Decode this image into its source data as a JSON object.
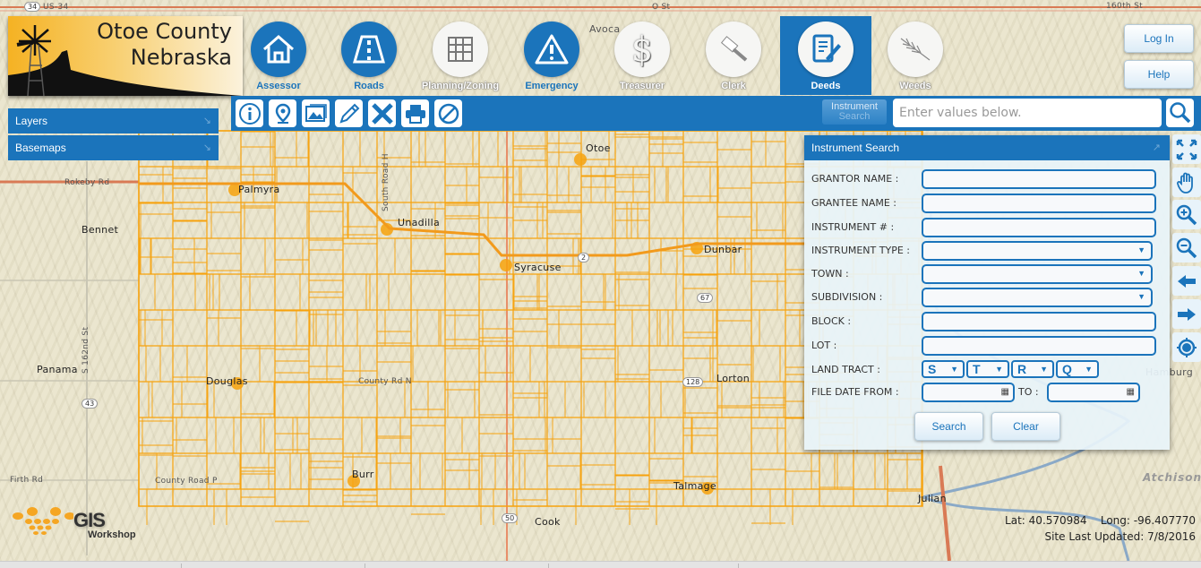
{
  "header": {
    "title_line1": "Otoe County",
    "title_line2": "Nebraska",
    "departments": [
      {
        "label": "Assessor",
        "icon": "house-icon",
        "style": "blue"
      },
      {
        "label": "Roads",
        "icon": "road-icon",
        "style": "blue"
      },
      {
        "label": "Planning/Zoning",
        "icon": "parcel-grid-icon",
        "style": "white"
      },
      {
        "label": "Emergency",
        "icon": "warning-icon",
        "style": "blue"
      },
      {
        "label": "Treasurer",
        "icon": "dollar-icon",
        "style": "white"
      },
      {
        "label": "Clerk",
        "icon": "gavel-icon",
        "style": "white"
      },
      {
        "label": "Deeds",
        "icon": "document-pen-icon",
        "style": "active"
      },
      {
        "label": "Weeds",
        "icon": "wheat-icon",
        "style": "white"
      }
    ],
    "login_label": "Log In",
    "help_label": "Help",
    "active_department": "Deeds"
  },
  "toolbar": {
    "tools": [
      {
        "name": "identify",
        "icon": "info-icon"
      },
      {
        "name": "locate",
        "icon": "map-pin-icon"
      },
      {
        "name": "imagery",
        "icon": "image-icon"
      },
      {
        "name": "draw",
        "icon": "pencil-icon"
      },
      {
        "name": "measure",
        "icon": "ruler-cross-icon"
      },
      {
        "name": "print",
        "icon": "printer-icon"
      },
      {
        "name": "clear",
        "icon": "no-icon"
      }
    ],
    "search_mode_line1": "Instrument",
    "search_mode_line2": "Search",
    "search_placeholder": "Enter values below.",
    "search_value": ""
  },
  "left_panels": {
    "layers_label": "Layers",
    "basemaps_label": "Basemaps"
  },
  "instrument_search": {
    "title": "Instrument Search",
    "fields": {
      "grantor": {
        "label": "GRANTOR NAME :",
        "value": ""
      },
      "grantee": {
        "label": "GRANTEE NAME :",
        "value": ""
      },
      "instrument_no": {
        "label": "INSTRUMENT # :",
        "value": ""
      },
      "instrument_type": {
        "label": "INSTRUMENT TYPE :",
        "value": ""
      },
      "town": {
        "label": "TOWN :",
        "value": ""
      },
      "subdivision": {
        "label": "SUBDIVISION :",
        "value": ""
      },
      "block": {
        "label": "BLOCK :",
        "value": ""
      },
      "lot": {
        "label": "LOT :",
        "value": ""
      },
      "land_tract": {
        "label": "LAND TRACT :",
        "s": "S",
        "t": "T",
        "r": "R",
        "q": "Q"
      },
      "file_date_from": {
        "label": "FILE DATE FROM :",
        "value": ""
      },
      "file_date_to": {
        "label": "TO :",
        "value": ""
      }
    },
    "search_label": "Search",
    "clear_label": "Clear"
  },
  "map_controls": [
    {
      "name": "full-extent",
      "icon": "expand-arrows-icon"
    },
    {
      "name": "pan",
      "icon": "hand-icon"
    },
    {
      "name": "zoom-in",
      "icon": "zoom-in-icon"
    },
    {
      "name": "zoom-out",
      "icon": "zoom-out-icon"
    },
    {
      "name": "previous-extent",
      "icon": "arrow-left-icon"
    },
    {
      "name": "next-extent",
      "icon": "arrow-right-icon"
    },
    {
      "name": "my-location",
      "icon": "locate-icon"
    }
  ],
  "map": {
    "places": [
      "Otoe",
      "Palmyra",
      "Unadilla",
      "Syracuse",
      "Dunbar",
      "Bennet",
      "Panama",
      "Douglas",
      "Lorton",
      "Burr",
      "Talmage",
      "Cook",
      "Julian",
      "Avoca",
      "Hamburg",
      "Atchison"
    ],
    "roads": [
      "US-34",
      "O St",
      "Rokeby Rd",
      "Firth Rd",
      "County Road P",
      "County Rd N",
      "S 162nd St",
      "South Road H",
      "NE-2",
      "160th St"
    ],
    "shields": [
      "34",
      "43",
      "50",
      "67",
      "128",
      "2"
    ],
    "parcel_color": "#f7a20c",
    "road_color": "#d97a55"
  },
  "footer": {
    "brand_main": "GIS",
    "brand_sub": "Workshop",
    "lat_label": "Lat:",
    "lat": "40.570984",
    "long_label": "Long:",
    "long": "-96.407770",
    "updated_label": "Site Last Updated:",
    "updated": "7/8/2016"
  },
  "colors": {
    "primary_blue": "#1b74bb",
    "logo_gold": "#f5b223"
  }
}
